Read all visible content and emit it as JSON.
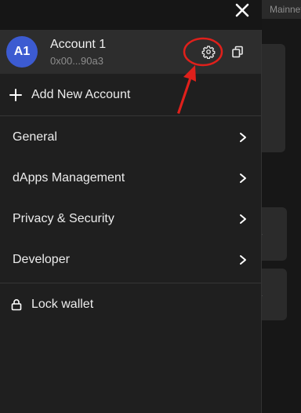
{
  "background": {
    "network_label": "Mainnet"
  },
  "account": {
    "avatar_initials": "A1",
    "name": "Account 1",
    "address": "0x00...90a3"
  },
  "add_account_label": "Add New Account",
  "menu": {
    "items": [
      {
        "label": "General"
      },
      {
        "label": "dApps Management"
      },
      {
        "label": "Privacy & Security"
      },
      {
        "label": "Developer"
      }
    ]
  },
  "lock_label": "Lock wallet",
  "colors": {
    "avatar": "#3c5bd1",
    "annotation": "#e0201b"
  },
  "icons": {
    "close": "close-icon",
    "settings": "gear-icon",
    "copy": "copy-icon",
    "add": "plus-icon",
    "chevron": "chevron-right-icon",
    "lock": "lock-icon"
  }
}
